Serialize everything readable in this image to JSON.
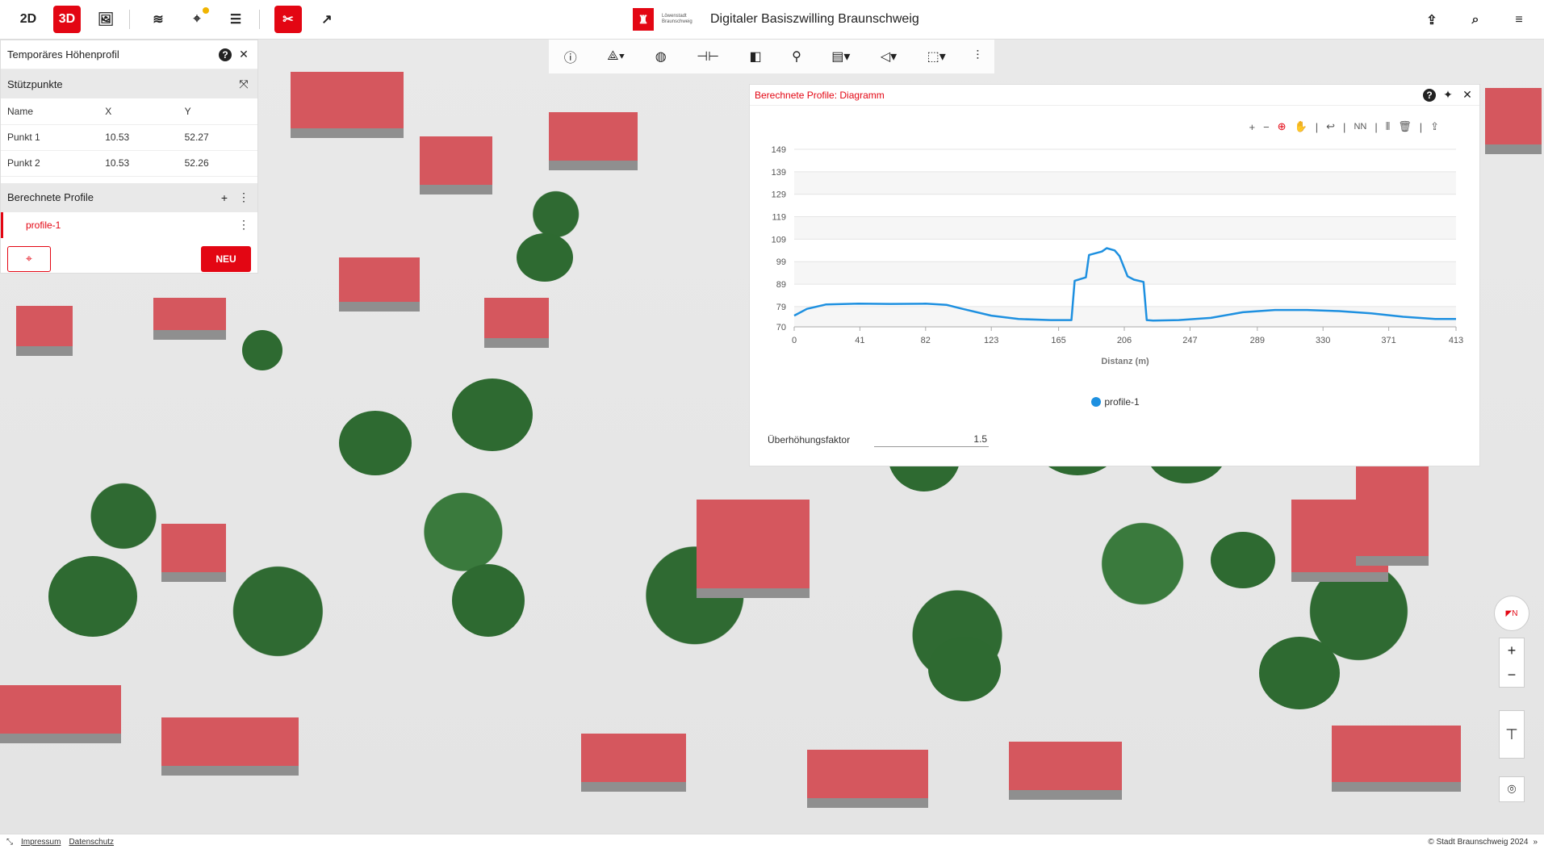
{
  "topbar": {
    "btn_2d": "2D",
    "btn_3d": "3D",
    "brand_sub": "Löwenstadt Braunschweig",
    "title": "Digitaler Basiszwilling Braunschweig"
  },
  "icons": {
    "image": "image-icon",
    "layers": "layers-icon",
    "map_tools": "map-tools-icon",
    "legend": "legend-list-icon",
    "tools": "tools-icon",
    "external": "external-link-icon",
    "share": "share-icon",
    "search": "search-icon",
    "menu": "menu-icon"
  },
  "left_panel": {
    "title": "Temporäres Höhenprofil",
    "section_points": "Stützpunkte",
    "columns": [
      "Name",
      "X",
      "Y"
    ],
    "rows": [
      {
        "name": "Punkt 1",
        "x": "10.53",
        "y": "52.27"
      },
      {
        "name": "Punkt 2",
        "x": "10.53",
        "y": "52.26"
      }
    ],
    "section_profiles": "Berechnete Profile",
    "profile_name": "profile-1",
    "new_label": "NEU"
  },
  "diagram": {
    "title": "Berechnete Profile: Diagramm",
    "tool_nn": "NN",
    "factor_label": "Überhöhungsfaktor",
    "factor_value": "1.5"
  },
  "chart_data": {
    "type": "line",
    "xlabel": "Distanz (m)",
    "ylabel": "",
    "xlim": [
      0,
      413
    ],
    "ylim": [
      70,
      149
    ],
    "x_ticks": [
      0,
      41,
      82,
      123,
      165,
      206,
      247,
      289,
      330,
      371,
      413
    ],
    "y_ticks": [
      70,
      79,
      89,
      99,
      109,
      119,
      129,
      139,
      149
    ],
    "legend_position": "bottom",
    "grid": true,
    "series": [
      {
        "name": "profile-1",
        "color": "#1e90e0",
        "x": [
          0,
          8,
          20,
          40,
          60,
          82,
          95,
          105,
          123,
          140,
          160,
          173,
          175,
          182,
          184,
          192,
          195,
          200,
          203,
          208,
          212,
          218,
          220,
          224,
          240,
          260,
          280,
          300,
          320,
          340,
          360,
          380,
          400,
          413
        ],
        "y": [
          75,
          78,
          80,
          80.3,
          80.2,
          80.3,
          79.8,
          78,
          75,
          73.5,
          73,
          73,
          90.5,
          92,
          102,
          103.5,
          105,
          104,
          101.5,
          92.5,
          91,
          90,
          73,
          72.8,
          73,
          74,
          76.5,
          77.5,
          77.5,
          77,
          76,
          74.5,
          73.5,
          73.5
        ]
      }
    ]
  },
  "footer": {
    "impressum": "Impressum",
    "datenschutz": "Datenschutz",
    "copyright": "© Stadt Braunschweig 2024"
  }
}
